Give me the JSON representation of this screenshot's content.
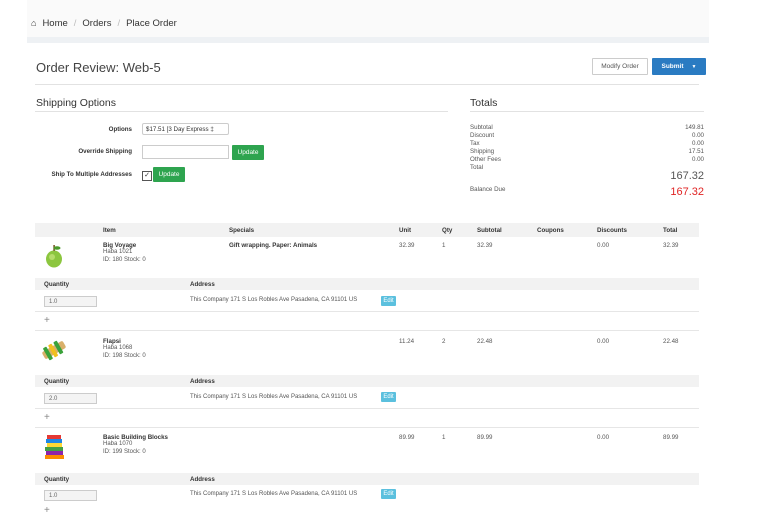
{
  "breadcrumb": {
    "home": "Home",
    "orders": "Orders",
    "current": "Place Order"
  },
  "page": {
    "title": "Order Review: Web-5"
  },
  "actions": {
    "modify": "Modify Order",
    "submit": "Submit"
  },
  "shipping": {
    "heading": "Shipping Options",
    "options_label": "Options",
    "options_value": "$17.51 [3 Day Express ‡",
    "override_label": "Override Shipping",
    "override_button": "Update",
    "multi_label": "Ship To Multiple Addresses",
    "multi_button": "Update",
    "multi_checked": true
  },
  "totals": {
    "heading": "Totals",
    "rows": [
      {
        "label": "Subtotal",
        "value": "149.81"
      },
      {
        "label": "Discount",
        "value": "0.00"
      },
      {
        "label": "Tax",
        "value": "0.00"
      },
      {
        "label": "Shipping",
        "value": "17.51"
      },
      {
        "label": "Other Fees",
        "value": "0.00"
      }
    ],
    "total_label": "Total",
    "total_value": "167.32",
    "balance_label": "Balance Due",
    "balance_value": "167.32"
  },
  "table": {
    "headers": [
      "Item",
      "Specials",
      "Unit",
      "Qty",
      "Subtotal",
      "Coupons",
      "Discounts",
      "Total"
    ],
    "quantity_header": "Quantity",
    "address_header": "Address",
    "edit_label": "Edit",
    "plus": "+",
    "items": [
      {
        "name": "Big Voyage",
        "brand": "Haba 1021",
        "meta": "ID: 180 Stock: 0",
        "specials": "Gift wrapping. Paper: Animals",
        "unit": "32.39",
        "qty": "1",
        "subtotal": "32.39",
        "coupons": "",
        "discounts": "0.00",
        "total": "32.39",
        "quantity_value": "1.0",
        "address": "This Company 171 S Los Robles Ave Pasadena, CA 91101 US",
        "icon": "apple-toy-icon"
      },
      {
        "name": "Flapsi",
        "brand": "Haba 1068",
        "meta": "ID: 198 Stock: 0",
        "specials": "",
        "unit": "11.24",
        "qty": "2",
        "subtotal": "22.48",
        "coupons": "",
        "discounts": "0.00",
        "total": "22.48",
        "quantity_value": "2.0",
        "address": "This Company 171 S Los Robles Ave Pasadena, CA 91101 US",
        "icon": "wooden-flapsi-toy-icon"
      },
      {
        "name": "Basic Building Blocks",
        "brand": "Haba 1070",
        "meta": "ID: 199 Stock: 0",
        "specials": "",
        "unit": "89.99",
        "qty": "1",
        "subtotal": "89.99",
        "coupons": "",
        "discounts": "0.00",
        "total": "89.99",
        "quantity_value": "1.0",
        "address": "This Company 171 S Los Robles Ave Pasadena, CA 91101 US",
        "icon": "building-blocks-icon"
      }
    ]
  },
  "colors": {
    "submit": "#2a7bc2",
    "update": "#2ea44f",
    "edit": "#5bc0de",
    "total": "#555555",
    "balance": "#e02424"
  }
}
